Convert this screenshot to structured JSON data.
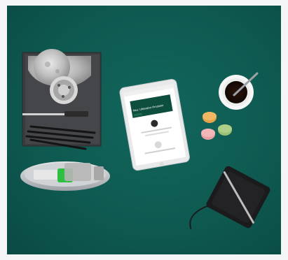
{
  "image": {
    "scene": "flat-lay",
    "background_color": "#0f5c53",
    "frame_color": "#f4f5f6"
  },
  "tablet": {
    "banner_heading": "Neu: Ultimative Produkte",
    "accent_color": "#1f6b4f"
  },
  "colors": {
    "notebook": "#3c3d40",
    "tray": "#c9ccce",
    "cup_rim": "#f2f2f2",
    "coffee": "#1b0e08",
    "macaron_pink": "#e9a0a4",
    "macaron_orange": "#e8a34a",
    "macaron_green": "#9bbf73",
    "journal": "#1c1c1e"
  }
}
